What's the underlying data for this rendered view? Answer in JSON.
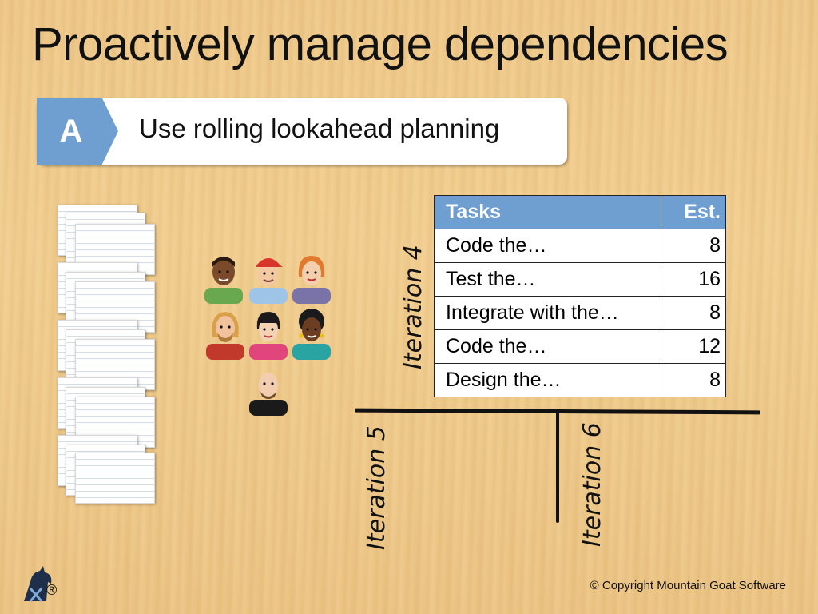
{
  "slide": {
    "title": "Proactively manage dependencies",
    "badge_letter": "A",
    "banner_text": "Use rolling lookahead planning"
  },
  "iterations": {
    "iteration4": "Iteration 4",
    "iteration5": "Iteration 5",
    "iteration6": "Iteration 6"
  },
  "task_table": {
    "headers": [
      "Tasks",
      "Est."
    ],
    "rows": [
      {
        "task": "Code the…",
        "est": "8"
      },
      {
        "task": "Test the…",
        "est": "16"
      },
      {
        "task": "Integrate with the…",
        "est": "8"
      },
      {
        "task": "Code the…",
        "est": "12"
      },
      {
        "task": "Design the…",
        "est": "8"
      }
    ]
  },
  "footer": {
    "copyright": "© Copyright Mountain Goat Software",
    "registered_mark": "®"
  },
  "colors": {
    "accent_blue": "#6f9fd0",
    "wood": "#efc98a"
  }
}
